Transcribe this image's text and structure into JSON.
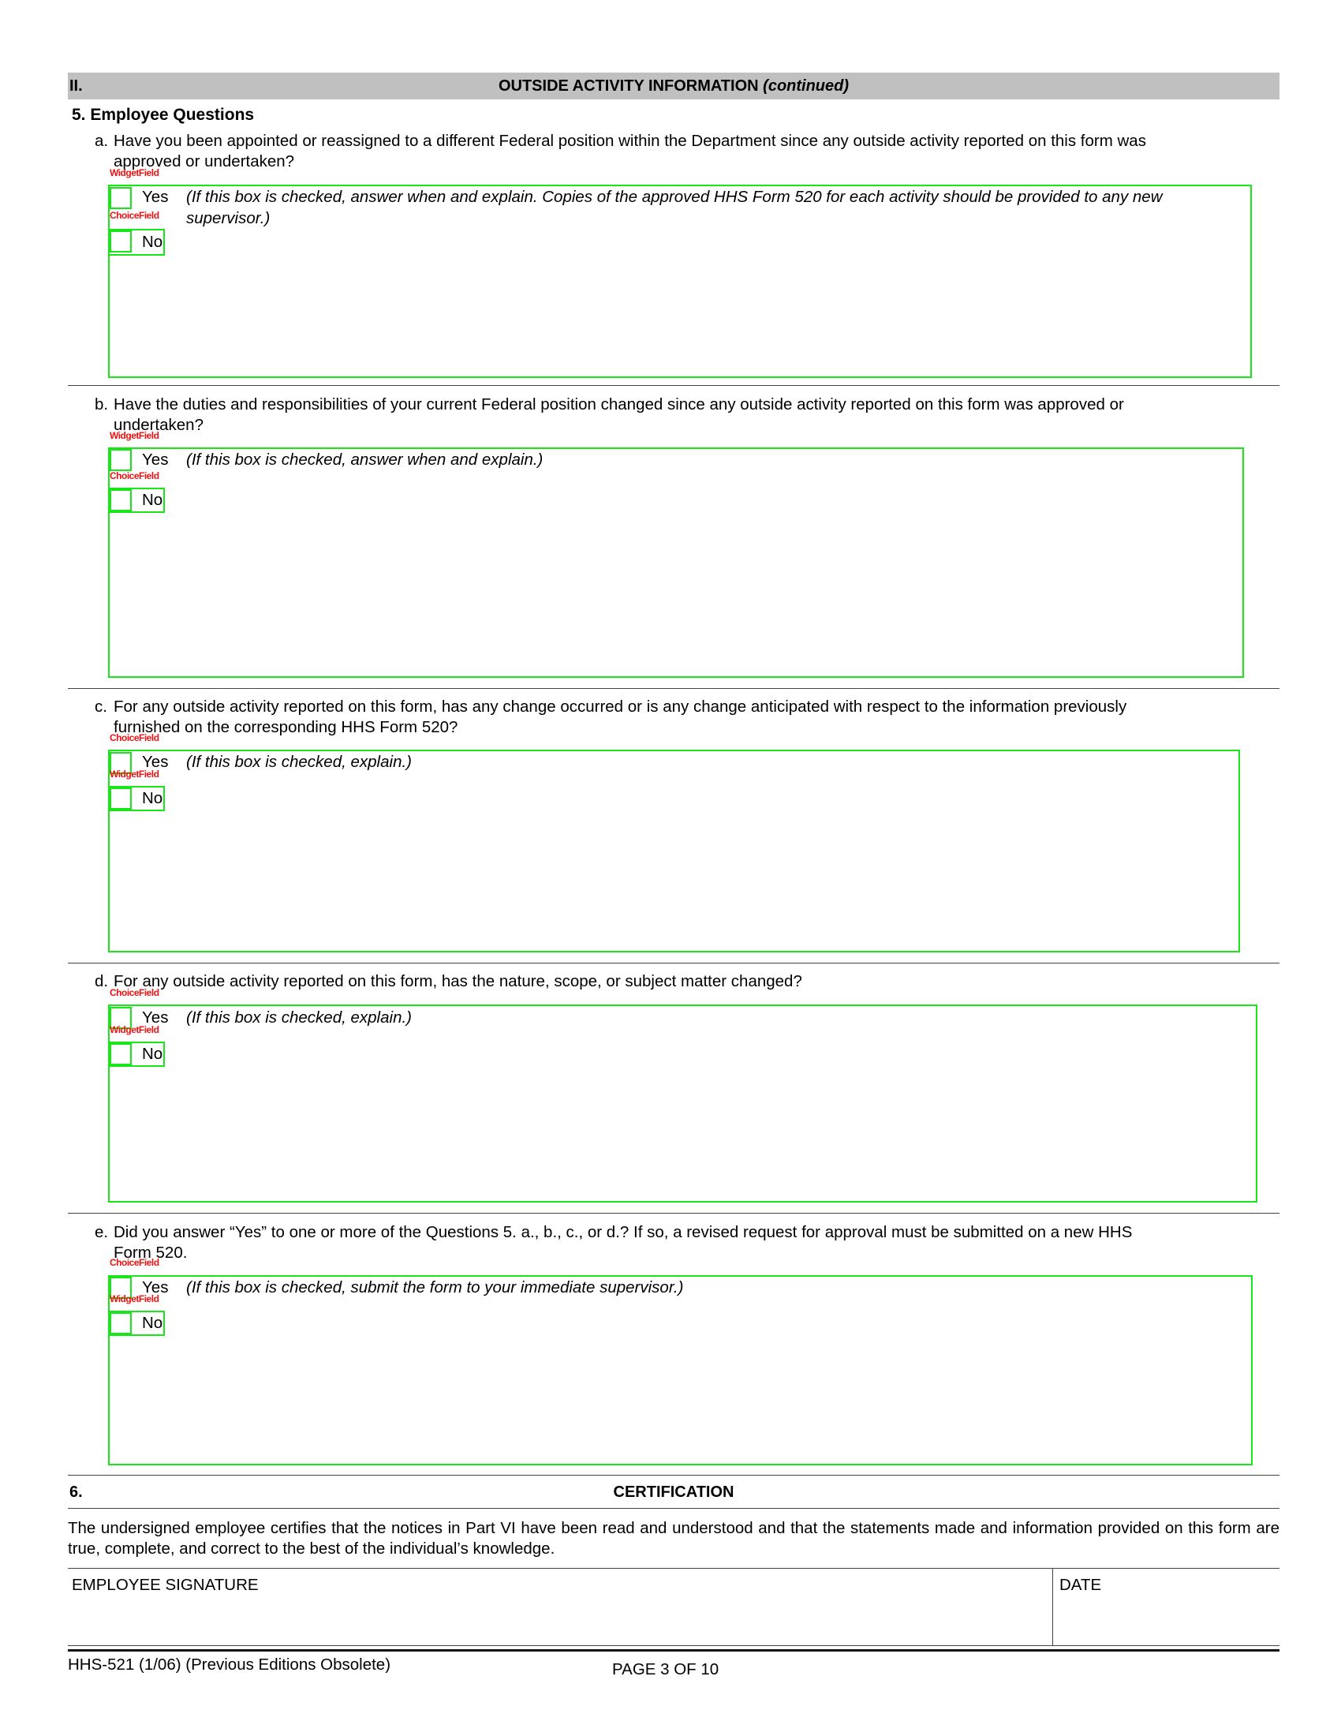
{
  "section": {
    "number": "II.",
    "title": "OUTSIDE ACTIVITY INFORMATION",
    "title_suffix": "(continued)"
  },
  "subsection_title": "5. Employee Questions",
  "widget_labels": {
    "widget": "Widget",
    "field": "Field",
    "choice": "Choice"
  },
  "questions": [
    {
      "label": "a.",
      "line1": "Have you been appointed or reassigned to a different Federal position within the Department since any outside activity reported on this form was",
      "line2": "approved or undertaken?",
      "yes": "Yes",
      "no": "No",
      "hint_line1": "(If this box is checked, answer when and explain. Copies of the approved HHS Form 520 for each activity should be provided to any new",
      "hint_line2": "supervisor.)"
    },
    {
      "label": "b.",
      "line1": "Have the duties and responsibilities of your current Federal position changed since any outside activity reported on this form was approved or",
      "line2": "undertaken?",
      "yes": "Yes",
      "no": "No",
      "hint_line1": "(If this box is checked, answer when and explain.)",
      "hint_line2": ""
    },
    {
      "label": "c.",
      "line1": "For any outside activity reported on this form, has any change occurred or is any change anticipated with respect to the information previously",
      "line2": "furnished on the corresponding HHS Form 520?",
      "yes": "Yes",
      "no": "No",
      "hint_line1": "(If this box is checked, explain.)",
      "hint_line2": ""
    },
    {
      "label": "d.",
      "line1": "For any outside activity reported on this form, has the nature, scope, or subject matter changed?",
      "line2": "",
      "yes": "Yes",
      "no": "No",
      "hint_line1": "(If this box is checked, explain.)",
      "hint_line2": ""
    },
    {
      "label": "e.",
      "line1": "Did you answer “Yes” to one or more of the Questions 5. a., b., c., or d.? If so, a revised request for approval must be submitted on a new  HHS",
      "line2": "Form 520.",
      "yes": "Yes",
      "no": "No",
      "hint_line1": "(If this box is checked, submit the form to your immediate supervisor.)",
      "hint_line2": ""
    }
  ],
  "certification": {
    "number": "6.",
    "title": "CERTIFICATION",
    "text": "The undersigned employee certifies that the notices in Part VI have been read and understood and that the statements made and information provided on this form are true, complete, and correct to the best of the individual’s knowledge.",
    "signature_label": "EMPLOYEE SIGNATURE",
    "date_label": "DATE"
  },
  "footer": {
    "form_id": "HHS-521 (1/06) (Previous Editions Obsolete)",
    "page": "PAGE 3 OF 10"
  },
  "colors": {
    "header_bar": "#c0c0c0",
    "widget_outline": "#19e619",
    "widget_label": "#ee1111"
  }
}
